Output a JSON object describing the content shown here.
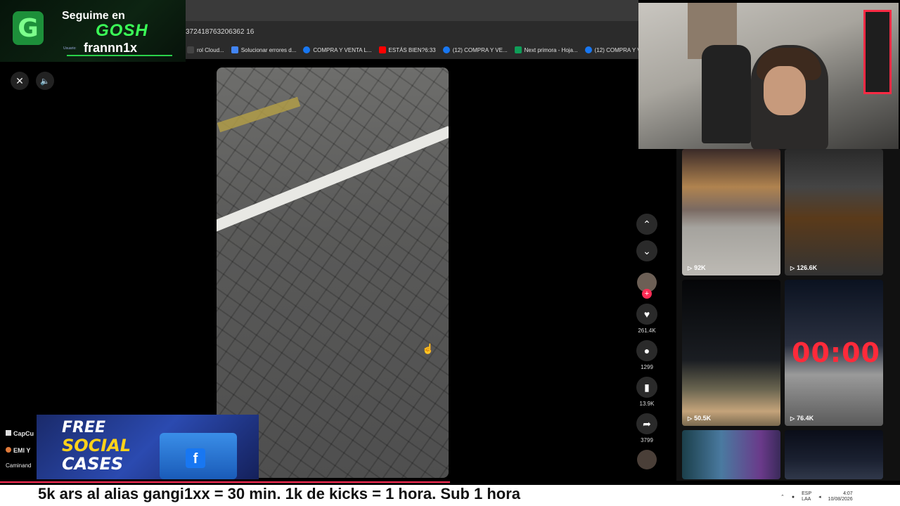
{
  "browser": {
    "url": "372418763206362 16",
    "bookmarks": [
      {
        "label": "rol Cloud...",
        "color": "#444444"
      },
      {
        "label": "Solucionar errores d...",
        "color": "#4285f4"
      },
      {
        "label": "COMPRA Y VENTA L...",
        "color": "#1877f2"
      },
      {
        "label": "ESTÁS BIEN?6:33",
        "color": "#ff0000"
      },
      {
        "label": "(12) COMPRA Y VE...",
        "color": "#1877f2"
      },
      {
        "label": "Next primora - Hoja...",
        "color": "#0f9d58"
      },
      {
        "label": "(12) COMPRA Y VE...",
        "color": "#1877f2"
      }
    ]
  },
  "banner": {
    "logo_letter": "G",
    "line1": "Seguime en",
    "line2": "GOSH",
    "user_label": "Usuario:",
    "username": "frannn1x"
  },
  "player": {
    "close_icon": "close-icon",
    "volume_icon": "volume-icon"
  },
  "actions": {
    "likes": "261.4K",
    "comments": "1299",
    "saves": "13.9K",
    "shares": "3799"
  },
  "thumbnails": [
    {
      "views": "92K"
    },
    {
      "views": "126.6K"
    },
    {
      "views": "50.5K"
    },
    {
      "views": "76.4K",
      "overlay": "00:00"
    },
    {
      "views": ""
    },
    {
      "views": ""
    }
  ],
  "chat": {
    "line1": "CapCu",
    "line2": "EMI Y",
    "line3": "Caminand"
  },
  "promo": {
    "line1": "FREE",
    "line2": "SOCIAL",
    "line3": "CASES",
    "fb": "f"
  },
  "subtitle": "5k ars al alias gangi1xx = 30 min. 1k de kicks = 1 hora. Sub 1 hora",
  "tray": {
    "lang1": "ESP",
    "lang2": "LAA",
    "time": "4:07",
    "date": "10/08/2026"
  }
}
